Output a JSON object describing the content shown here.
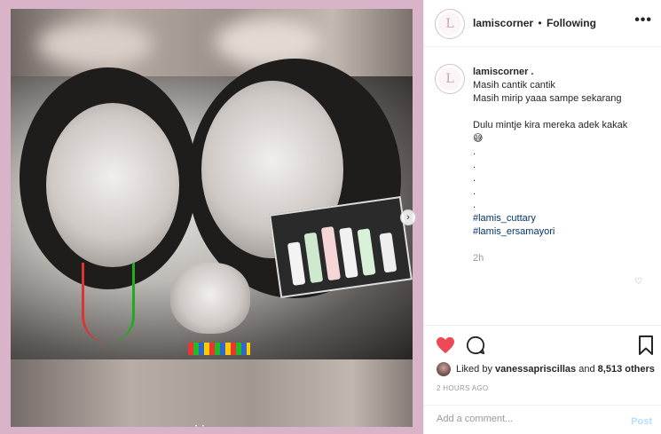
{
  "header": {
    "username": "lamiscorner",
    "separator": "•",
    "follow_status": "Following",
    "more_label": "•••"
  },
  "avatar_glyph": "L",
  "caption": {
    "username": "lamiscorner .",
    "lines": [
      "Masih cantik cantik",
      "Masih mirip yaaa sampe sekarang",
      "",
      "Dulu mintje kira mereka adek kakak",
      "😅",
      ".",
      ".",
      ".",
      ".",
      "."
    ],
    "hashtags": [
      "#lamis_cuttary",
      "#lamis_ersamayori"
    ],
    "time": "2h"
  },
  "likes": {
    "prefix": "Liked by",
    "user": "vanessapriscillas",
    "connector": "and",
    "count": "8,513 others"
  },
  "post_time": "2 HOURS AGO",
  "add_comment": {
    "placeholder": "Add a comment...",
    "post_label": "Post"
  },
  "colors": {
    "frame": "#d9b4c8",
    "like_heart": "#ed4956",
    "link": "#003569",
    "post_disabled": "#b2dffc"
  },
  "icons": {
    "like": "heart-filled-icon",
    "comment": "comment-bubble-icon",
    "save": "bookmark-icon",
    "next": "chevron-right-icon",
    "comment_like": "heart-outline-icon"
  }
}
